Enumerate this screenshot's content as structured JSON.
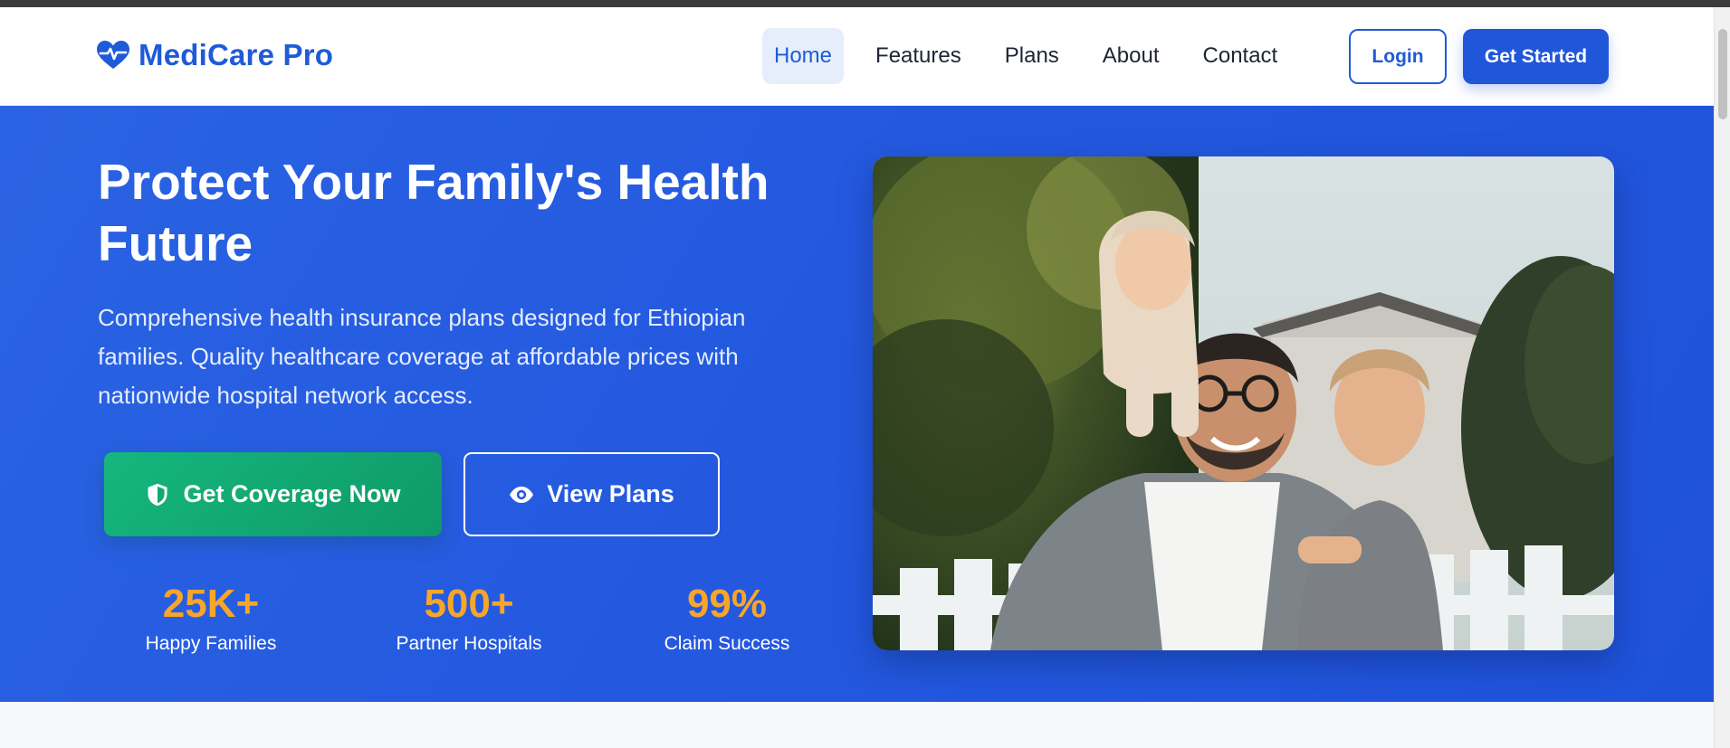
{
  "brand": {
    "name": "MediCare Pro",
    "icon": "heart-pulse-icon",
    "color": "#1f5bd8"
  },
  "nav": {
    "links": [
      {
        "label": "Home",
        "active": true
      },
      {
        "label": "Features",
        "active": false
      },
      {
        "label": "Plans",
        "active": false
      },
      {
        "label": "About",
        "active": false
      },
      {
        "label": "Contact",
        "active": false
      }
    ],
    "login_label": "Login",
    "start_label": "Get Started"
  },
  "hero": {
    "title": "Protect Your Family's Health Future",
    "description": "Comprehensive health insurance plans designed for Ethiopian families. Quality healthcare coverage at affordable prices with nationwide hospital network access.",
    "primary_cta": {
      "label": "Get Coverage Now",
      "icon": "shield-icon",
      "color": "#16b67e"
    },
    "secondary_cta": {
      "label": "View Plans",
      "icon": "eye-icon"
    },
    "stats": [
      {
        "value": "25K+",
        "label": "Happy Families"
      },
      {
        "value": "500+",
        "label": "Partner Hospitals"
      },
      {
        "value": "99%",
        "label": "Claim Success"
      }
    ],
    "stat_color": "#f7a62a",
    "background": "#2459df"
  }
}
